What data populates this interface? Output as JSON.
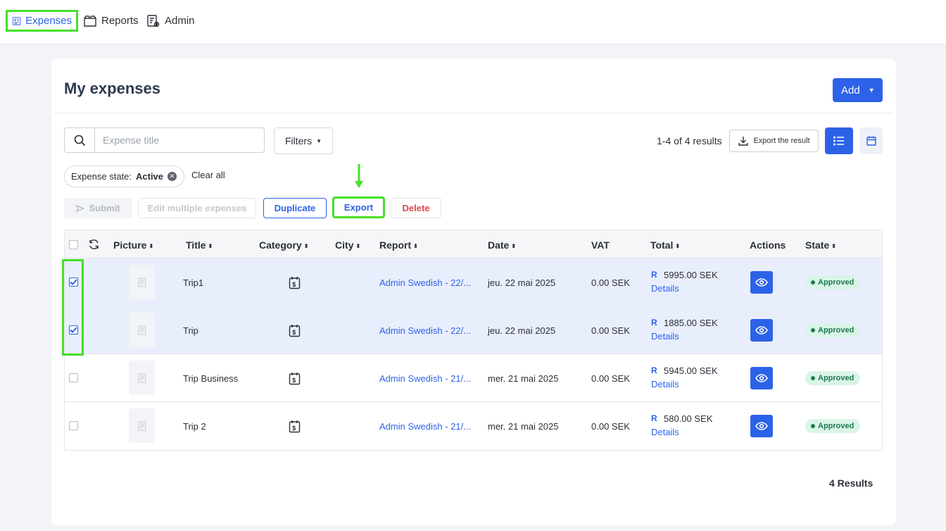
{
  "nav": {
    "expenses": "Expenses",
    "reports": "Reports",
    "admin": "Admin"
  },
  "page": {
    "title": "My expenses",
    "add_label": "Add"
  },
  "search": {
    "placeholder": "Expense title",
    "value": ""
  },
  "filters_label": "Filters",
  "results_count": "1-4 of 4 results",
  "export_result_label": "Export the result",
  "chip": {
    "prefix": "Expense state:",
    "value": "Active"
  },
  "clear_all": "Clear all",
  "actions": {
    "submit": "Submit",
    "edit_multiple": "Edit multiple expenses",
    "duplicate": "Duplicate",
    "export": "Export",
    "delete": "Delete"
  },
  "columns": {
    "picture": "Picture",
    "title": "Title",
    "category": "Category",
    "city": "City",
    "report": "Report",
    "date": "Date",
    "vat": "VAT",
    "total": "Total",
    "actions": "Actions",
    "state": "State"
  },
  "rows": [
    {
      "selected": true,
      "title": "Trip1",
      "city": "",
      "report": "Admin Swedish - 22/...",
      "date": "jeu. 22 mai 2025",
      "vat": "0.00 SEK",
      "total_symbol": "R",
      "total": "5995.00 SEK",
      "details": "Details",
      "state": "Approved"
    },
    {
      "selected": true,
      "title": "Trip",
      "city": "",
      "report": "Admin Swedish - 22/...",
      "date": "jeu. 22 mai 2025",
      "vat": "0.00 SEK",
      "total_symbol": "R",
      "total": "1885.00 SEK",
      "details": "Details",
      "state": "Approved"
    },
    {
      "selected": false,
      "title": "Trip Business",
      "city": "",
      "report": "Admin Swedish - 21/...",
      "date": "mer. 21 mai 2025",
      "vat": "0.00 SEK",
      "total_symbol": "R",
      "total": "5945.00 SEK",
      "details": "Details",
      "state": "Approved"
    },
    {
      "selected": false,
      "title": "Trip 2",
      "city": "",
      "report": "Admin Swedish - 21/...",
      "date": "mer. 21 mai 2025",
      "vat": "0.00 SEK",
      "total_symbol": "R",
      "total": "580.00 SEK",
      "details": "Details",
      "state": "Approved"
    }
  ],
  "footer_results": "4 Results",
  "colors": {
    "accent": "#2d62e8",
    "highlight": "#44e02a",
    "approved_bg": "#d9f5e7",
    "approved_text": "#1d7a4d",
    "danger": "#e0454d"
  },
  "icons": {
    "expenses": "receipt-icon",
    "reports": "folder-icon",
    "admin": "admin-settings-icon",
    "search": "search-icon",
    "export_result": "download-icon",
    "list_view": "list-icon",
    "calendar_view": "calendar-icon",
    "submit": "send-icon",
    "refresh": "refresh-icon",
    "category": "money-calendar-icon",
    "view": "eye-icon"
  }
}
